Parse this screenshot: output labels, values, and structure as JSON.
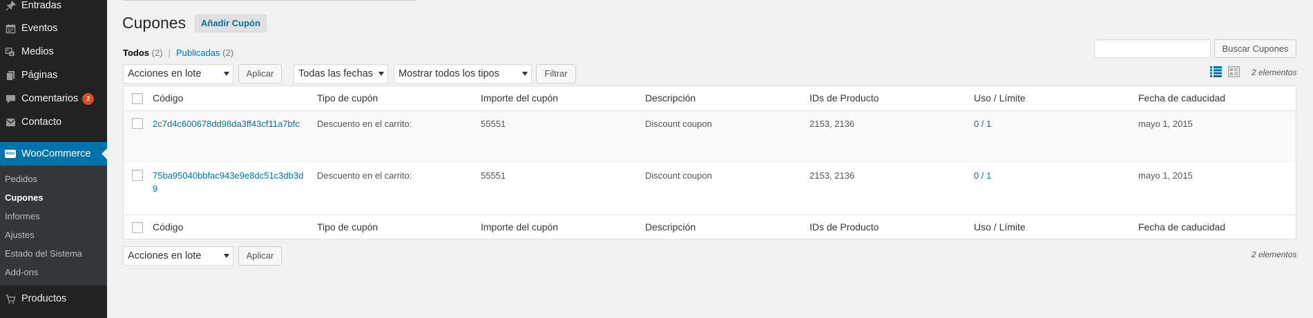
{
  "sidebar": {
    "items": [
      {
        "label": "Entradas",
        "icon": "pin-icon"
      },
      {
        "label": "Eventos",
        "icon": "calendar-icon"
      },
      {
        "label": "Medios",
        "icon": "media-icon"
      },
      {
        "label": "Páginas",
        "icon": "pages-icon"
      },
      {
        "label": "Comentarios",
        "icon": "comment-icon",
        "badge": "2"
      },
      {
        "label": "Contacto",
        "icon": "mail-icon"
      },
      {
        "label": "WooCommerce",
        "icon": "woo-icon"
      },
      {
        "label": "Productos",
        "icon": "cart-icon"
      }
    ],
    "woo_icon_text": "woo",
    "submenu": [
      "Pedidos",
      "Cupones",
      "Informes",
      "Ajustes",
      "Estado del Sistema",
      "Add-ons"
    ],
    "submenu_current": "Cupones"
  },
  "header": {
    "title": "Cupones",
    "add_button": "Añadir Cupón"
  },
  "filters": {
    "all_label": "Todos",
    "all_count": "(2)",
    "separator": "|",
    "published_label": "Publicadas",
    "published_count": "(2)"
  },
  "search": {
    "button_label": "Buscar Cupones",
    "value": ""
  },
  "toolbar": {
    "bulk_actions": "Acciones en lote",
    "apply_label": "Aplicar",
    "date_filter": "Todas las fechas",
    "type_filter": "Mostrar todos los tipos",
    "filter_label": "Filtrar",
    "item_count": "2 elementos"
  },
  "view_icons": [
    "list-view-icon",
    "excerpt-view-icon"
  ],
  "table": {
    "columns": [
      "Código",
      "Tipo de cupón",
      "Importe del cupón",
      "Descripción",
      "IDs de Producto",
      "Uso / Límite",
      "Fecha de caducidad"
    ],
    "rows": [
      {
        "code": "2c7d4c600678dd98da3ff43cf11a7bfc",
        "type": "Descuento en el carrito:",
        "amount": "55551",
        "description": "Discount coupon",
        "product_ids": "2153, 2136",
        "usage": "0",
        "limit": "/ 1",
        "expiry": "mayo 1, 2015"
      },
      {
        "code": "75ba95040bbfac943e9e8dc51c3db3d9",
        "type": "Descuento en el carrito:",
        "amount": "55551",
        "description": "Discount coupon",
        "product_ids": "2153, 2136",
        "usage": "0",
        "limit": "/ 1",
        "expiry": "mayo 1, 2015"
      }
    ]
  },
  "colors": {
    "accent": "#0073aa",
    "sidebar_bg": "#222222",
    "submenu_bg": "#32373c",
    "badge": "#d54e21",
    "page_bg": "#f1f1f1"
  }
}
